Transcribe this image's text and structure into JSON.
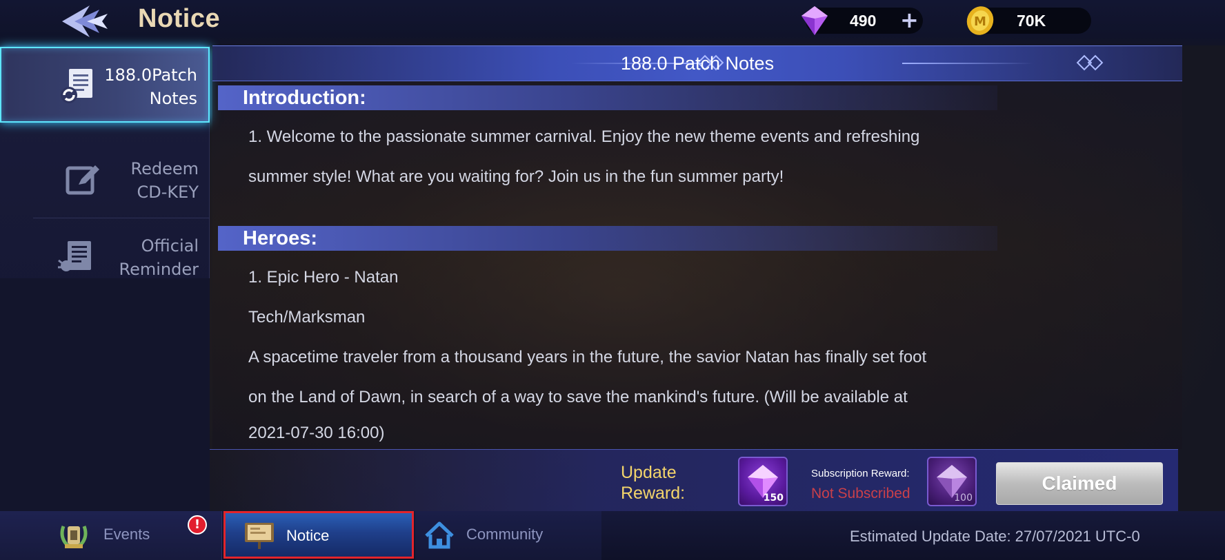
{
  "header": {
    "title": "Notice",
    "back_icon": "back-arrow-icon",
    "currencies": [
      {
        "icon": "diamond-icon",
        "value": "490",
        "add_label": "+"
      },
      {
        "icon": "battle-point-coin-icon",
        "value": "70K"
      }
    ]
  },
  "sidebar": {
    "items": [
      {
        "label": "188.0Patch\nNotes",
        "icon": "patch-notes-icon",
        "active": true
      },
      {
        "label": "Redeem\nCD-KEY",
        "icon": "edit-icon",
        "active": false
      },
      {
        "label": "Official\nReminder",
        "icon": "reminder-icon",
        "active": false
      }
    ]
  },
  "content": {
    "heading": "188.0 Patch Notes",
    "sections": [
      {
        "title": "Introduction:",
        "paragraphs": [
          "1. Welcome to the passionate summer carnival. Enjoy the new theme events and refreshing",
          "summer style! What are you waiting for? Join us in the fun summer party!"
        ]
      },
      {
        "title": "Heroes:",
        "paragraphs": [
          "1. Epic Hero - Natan",
          "Tech/Marksman",
          "A spacetime traveler from a thousand years in the future, the savior Natan has finally set foot",
          "on the Land of Dawn, in search of a way to save the mankind's future. (Will be available at",
          "2021-07-30 16:00)"
        ]
      }
    ]
  },
  "reward": {
    "label": "Update\nReward:",
    "update_reward_count": "150",
    "subscription_label": "Subscription Reward:",
    "subscription_status": "Not Subscribed",
    "subscription_reward_count": "100",
    "claim_button": "Claimed",
    "colors": {
      "label": "#f4d56b",
      "not_subscribed": "#c9404a"
    }
  },
  "bottom_tabs": [
    {
      "label": "Events",
      "icon": "events-laurel-icon",
      "badge": "!"
    },
    {
      "label": "Notice",
      "icon": "notice-board-icon",
      "selected": true
    },
    {
      "label": "Community",
      "icon": "home-icon"
    }
  ],
  "estimated_update": "Estimated Update Date: 27/07/2021 UTC-0"
}
